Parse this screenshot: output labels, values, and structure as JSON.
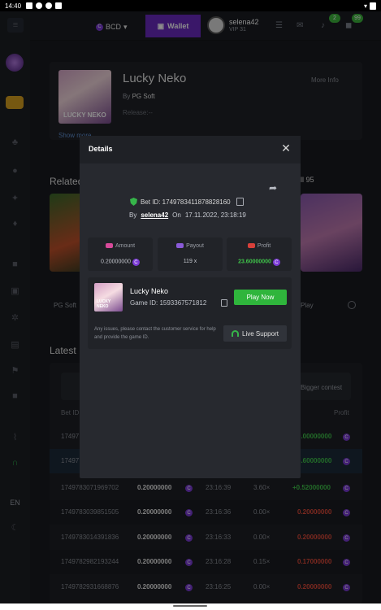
{
  "status_bar": {
    "time": "14:40"
  },
  "header": {
    "currency": "BCD",
    "wallet_label": "Wallet",
    "user": {
      "name": "selena42",
      "vip": "VIP 31"
    },
    "badges": [
      "2",
      "99"
    ]
  },
  "sidebar": {
    "lang": "EN"
  },
  "game": {
    "title": "Lucky Neko",
    "provider_label": "By",
    "provider": "PG Soft",
    "release": "Release:--",
    "more_info": "More Info",
    "show_more": "Show more",
    "thumb_text": "LUCKY NEKO"
  },
  "related": {
    "title": "Related",
    "count": "All 95",
    "items": [
      {
        "provider": "PG Soft"
      },
      {
        "provider": "Play"
      }
    ]
  },
  "latest": {
    "title": "Latest",
    "tab": "Bigger contest",
    "columns": [
      "Bet ID",
      "Profit"
    ],
    "rows": [
      {
        "bet_id": "17497",
        "amount": "",
        "time": "",
        "payout": "",
        "profit": "0.00000000",
        "profit_class": "green"
      },
      {
        "bet_id": "17497",
        "amount": "",
        "time": "",
        "payout": "",
        "profit": "3.60000000",
        "profit_class": "green"
      },
      {
        "bet_id": "1749783071969702",
        "amount": "0.20000000",
        "time": "23:16:39",
        "payout": "3.60×",
        "profit": "+0.52000000",
        "profit_class": "green"
      },
      {
        "bet_id": "1749783039851505",
        "amount": "0.20000000",
        "time": "23:16:36",
        "payout": "0.00×",
        "profit": "0.20000000",
        "profit_class": "red"
      },
      {
        "bet_id": "1749783014391836",
        "amount": "0.20000000",
        "time": "23:16:33",
        "payout": "0.00×",
        "profit": "0.20000000",
        "profit_class": "red"
      },
      {
        "bet_id": "1749782982193244",
        "amount": "0.20000000",
        "time": "23:16:28",
        "payout": "0.15×",
        "profit": "0.17000000",
        "profit_class": "red"
      },
      {
        "bet_id": "1749782931668876",
        "amount": "0.20000000",
        "time": "23:16:25",
        "payout": "0.00×",
        "profit": "0.20000000",
        "profit_class": "red"
      }
    ]
  },
  "modal": {
    "title": "Details",
    "bet_id": "Bet ID: 1749783411878828160",
    "by_label": "By",
    "by_user": "selena42",
    "on_label": "On",
    "date": "17.11.2022, 23:18:19",
    "amount_label": "Amount",
    "amount_value": "0.20000000",
    "payout_label": "Payout",
    "payout_value": "119 x",
    "profit_label": "Profit",
    "profit_value": "23.60000000",
    "game_name": "Lucky Neko",
    "game_id": "Game ID: 1593367571812",
    "play_label": "Play Now",
    "support_text": "Any issues, please contact the customer service for help and provide the game ID.",
    "support_label": "Live Support"
  },
  "colors": {
    "accent": "#6a2ac0",
    "green": "#2fb53c",
    "red": "#e04a3a"
  }
}
